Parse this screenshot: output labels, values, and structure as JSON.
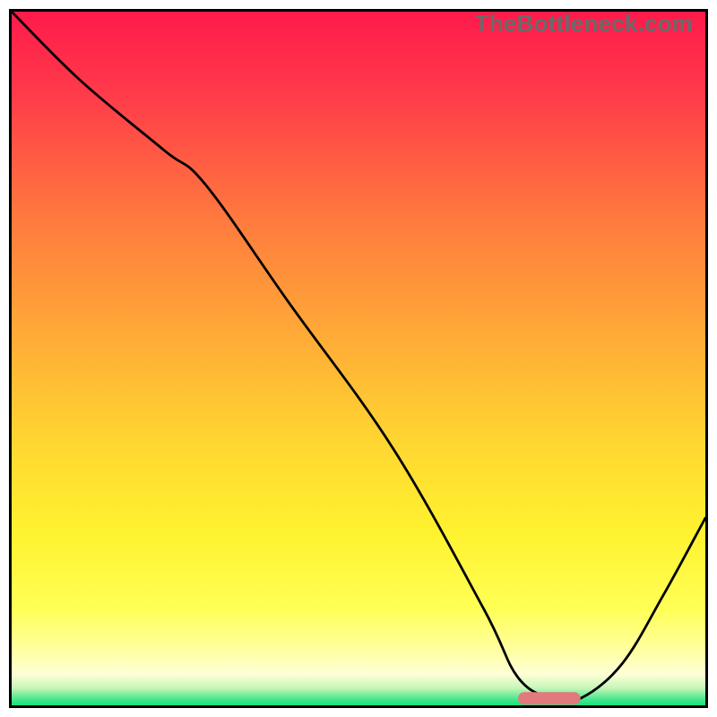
{
  "watermark": "TheBottleneck.com",
  "chart_data": {
    "type": "line",
    "title": "",
    "xlabel": "",
    "ylabel": "",
    "xlim": [
      0,
      100
    ],
    "ylim": [
      0,
      100
    ],
    "series": [
      {
        "name": "bottleneck-curve",
        "x": [
          0,
          10,
          22,
          28,
          40,
          55,
          68,
          73,
          78,
          82,
          88,
          94,
          100
        ],
        "y": [
          100,
          90,
          80,
          75,
          58,
          37,
          14,
          4,
          1,
          1,
          6,
          16,
          27
        ]
      }
    ],
    "marker": {
      "name": "optimal-range",
      "x_start": 73,
      "x_end": 82,
      "y": 1,
      "color": "#e27a7d"
    },
    "gradient_stops": [
      {
        "offset": 0.0,
        "color": "#ff1a4b"
      },
      {
        "offset": 0.12,
        "color": "#ff3b4a"
      },
      {
        "offset": 0.3,
        "color": "#ff7a3e"
      },
      {
        "offset": 0.48,
        "color": "#ffae36"
      },
      {
        "offset": 0.62,
        "color": "#ffd631"
      },
      {
        "offset": 0.75,
        "color": "#fff22f"
      },
      {
        "offset": 0.86,
        "color": "#ffff55"
      },
      {
        "offset": 0.92,
        "color": "#ffffa0"
      },
      {
        "offset": 0.955,
        "color": "#fdffd6"
      },
      {
        "offset": 0.975,
        "color": "#c6f6b7"
      },
      {
        "offset": 0.99,
        "color": "#4fe890"
      },
      {
        "offset": 1.0,
        "color": "#12e47a"
      }
    ]
  }
}
